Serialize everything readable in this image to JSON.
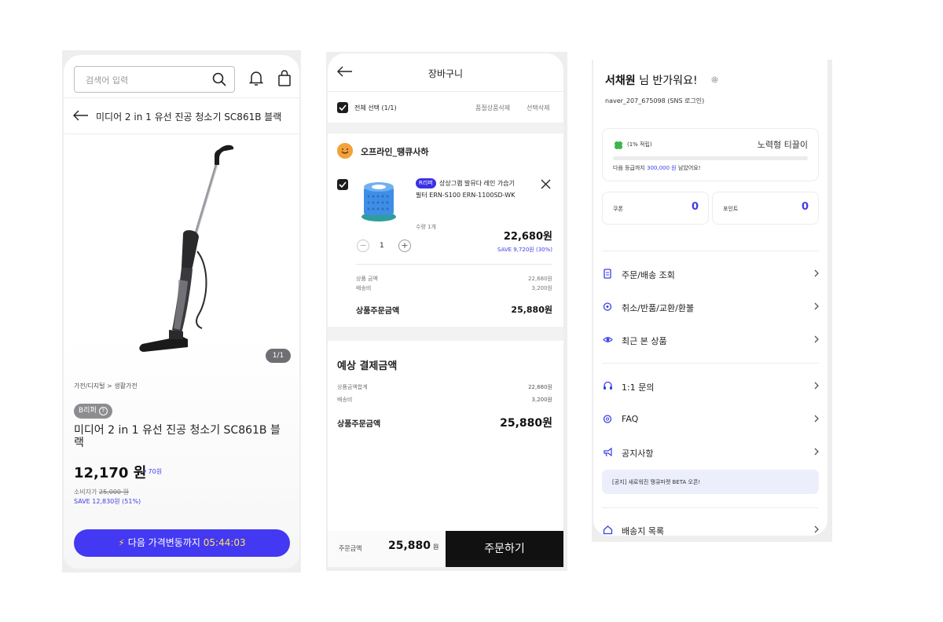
{
  "product_screen": {
    "search_placeholder": "검색어 입력",
    "title": "미디어 2 in 1 유선 진공 청소기 SC861B 블랙",
    "image_pager": "1/1",
    "category": "가전/디지털 > 생활가전",
    "badge": "B리퍼",
    "product_name": "미디어 2 in 1 유선 진공 청소기 SC861B 블랙",
    "price": "12,170 원",
    "price_drop": "▾ 70원",
    "consumer_label": "소비자가",
    "consumer_price": "25,000 원",
    "save_text": "SAVE 12,830원 (51%)",
    "cta_label": "다음 가격변동까지",
    "cta_timer": "05:44:03",
    "colors": {
      "accent": "#4339f2",
      "save": "#3d3de8"
    }
  },
  "cart_screen": {
    "title": "장바구니",
    "select_all": "전체 선택 (1/1)",
    "delete_soldout": "품절상품삭제",
    "delete_selected": "선택삭제",
    "store_name": "오프라인_땡큐사하",
    "item": {
      "badge": "R리퍼",
      "name_line1": "상상그램 발뮤다 레인 가습기",
      "name_line2": "필터 ERN-S100 ERN-1100SD-WK",
      "qty_label": "수량 1개",
      "qty": "1",
      "price": "22,680원",
      "save": "SAVE 9,720원 (30%)"
    },
    "item_summary": [
      {
        "label": "상품 금액",
        "value": "22,680원"
      },
      {
        "label": "배송비",
        "value": "3,200원"
      }
    ],
    "item_order_total_label": "상품주문금액",
    "item_order_total": "25,880원",
    "estimate_title": "예상 결제금액",
    "estimate_rows": [
      {
        "label": "상품금액합계",
        "value": "22,680원"
      },
      {
        "label": "배송비",
        "value": "3,200원"
      }
    ],
    "estimate_total_label": "상품주문금액",
    "estimate_total": "25,880원",
    "bottom_label": "주문금액",
    "bottom_amount": "25,880",
    "bottom_unit": "원",
    "order_button": "주문하기"
  },
  "mypage_screen": {
    "user_name": "서채원",
    "greeting_suffix": "님 반가워요!",
    "account": "naver_207_675098 (SNS 로그인)",
    "rate": "(1% 적립)",
    "grade": "노력형 티끌이",
    "progress": 0,
    "next_prefix": "다음 등급까지",
    "next_amount": "300,000 원",
    "next_suffix": "남았어요!",
    "coupon_label": "쿠폰",
    "coupon_value": "0",
    "point_label": "포인트",
    "point_value": "0",
    "menu": [
      {
        "label": "주문/배송 조회",
        "icon": "receipt-icon"
      },
      {
        "label": "취소/반품/교환/환불",
        "icon": "return-icon"
      },
      {
        "label": "최근 본 상품",
        "icon": "eye-icon"
      },
      {
        "label": "1:1 문의",
        "icon": "headset-icon"
      },
      {
        "label": "FAQ",
        "icon": "faq-icon"
      },
      {
        "label": "공지사항",
        "icon": "megaphone-icon"
      },
      {
        "label": "배송지 목록",
        "icon": "home-icon"
      }
    ],
    "notice_banner": "[공지] 새로워진 땡큐마켓 BETA 오픈!"
  }
}
